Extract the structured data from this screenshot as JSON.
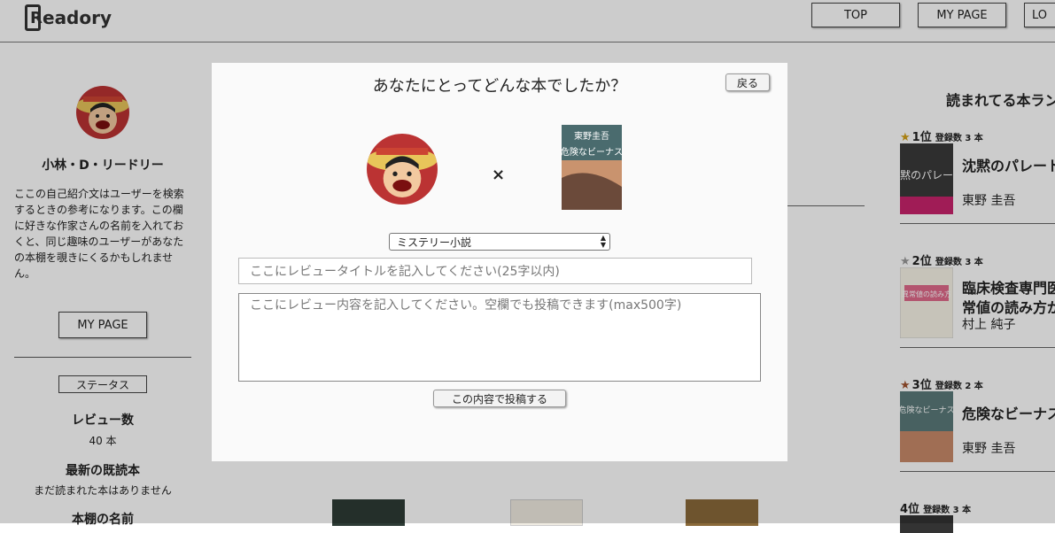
{
  "header": {
    "logo_letter": "R",
    "logo_text": "eadory",
    "nav": [
      "TOP",
      "MY PAGE",
      "LO"
    ]
  },
  "profile": {
    "name": "小林・D・リードリー",
    "bio": "ここの自己紹介文はユーザーを検索するときの参考になります。この欄に好きな作家さんの名前を入れておくと、同じ趣味のユーザーがあなたの本棚を覗きにくるかもしれません。",
    "my_page_label": "MY PAGE",
    "status_label": "ステータス",
    "stats": [
      {
        "label": "レビュー数",
        "value": "40 本"
      },
      {
        "label": "最新の既読本",
        "value": "まだ読まれた本はありません"
      },
      {
        "label": "本棚の名前",
        "value": ""
      }
    ]
  },
  "ranking": {
    "title": "読まれてる本ラン",
    "items": [
      {
        "pos": "1位",
        "count_label": "登録数 3 本",
        "star_color": "#d4a017",
        "title": "沈黙のパレート",
        "author": "東野 圭吾",
        "cover_text": "沈黙のパレード"
      },
      {
        "pos": "2位",
        "count_label": "登録数 3 本",
        "star_color": "#9a9a9a",
        "title": "臨床検査専門医",
        "title2": "常値の読み方が",
        "author": "村上 純子",
        "cover_text": "異常値の読み方"
      },
      {
        "pos": "3位",
        "count_label": "登録数 2 本",
        "star_color": "#a0522d",
        "title": "危険なビーナス",
        "author": "東野 圭吾",
        "cover_text": "危険なビーナス"
      },
      {
        "pos": "4位",
        "count_label": "登録数 3 本",
        "star_color": "",
        "title": "",
        "author": "",
        "cover_text": ""
      }
    ]
  },
  "modal": {
    "title": "あなたにとってどんな本でしたか？",
    "back_label": "戻る",
    "times": "×",
    "book_cover_text": "危険なビーナス",
    "book_author_text": "東野圭吾",
    "genre_selected": "ミステリー小説",
    "title_placeholder": "ここにレビュータイトルを記入してください(25字以内)",
    "content_placeholder": "ここにレビュー内容を記入してください。空欄でも投稿できます(max500字)",
    "submit_label": "この内容で投稿する"
  },
  "colors": {
    "overlay": "rgba(0,0,0,0.2)",
    "modal_bg": "#fafafa"
  }
}
